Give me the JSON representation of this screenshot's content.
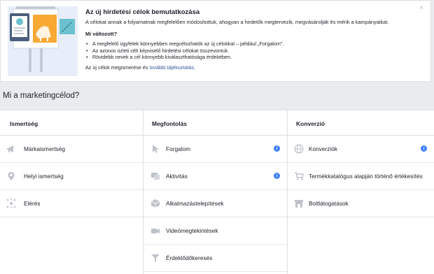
{
  "notice": {
    "title": "Az új hirdetési célok bemutatkozása",
    "text": "A célokat annak a folyamatnak megfelelően módosítottuk, ahogyan a hirdetők megtervezik, megvásárolják és mérik a kampányaikat.",
    "subtitle": "Mi változott?",
    "bullets": [
      "A megfelelő ügyfelek könnyebben megcélozhatók az új célokkal – például „Forgalom\".",
      "Az azonos üzleti célt képviselő hirdetési célokat összevontuk.",
      "Rövidebb nevek a cél könnyebb kiválaszthatósága érdekében."
    ],
    "more_prefix": "Az új célok megismerése és ",
    "more_link": "további tájékoztatás",
    "more_suffix": ".",
    "close": "×"
  },
  "question": "Mi a marketingcélod?",
  "columns": [
    {
      "header": "Ismertség",
      "items": [
        {
          "label": "Márkaismertség",
          "icon": "megaphone-icon"
        },
        {
          "label": "Helyi ismertség",
          "icon": "location-pin-icon"
        },
        {
          "label": "Elérés",
          "icon": "reach-burst-icon"
        }
      ]
    },
    {
      "header": "Megfontolás",
      "items": [
        {
          "label": "Forgalom",
          "icon": "cursor-icon",
          "info": "i"
        },
        {
          "label": "Aktivitás",
          "icon": "chat-bubbles-icon",
          "info": "i"
        },
        {
          "label": "Alkalmazástelepítések",
          "icon": "box-icon"
        },
        {
          "label": "Videómegtekintések",
          "icon": "video-camera-icon"
        },
        {
          "label": "Érdeklődőkeresés",
          "icon": "funnel-icon"
        }
      ]
    },
    {
      "header": "Konverzió",
      "items": [
        {
          "label": "Konverziók",
          "icon": "globe-icon",
          "info": "i"
        },
        {
          "label": "Termékkatalógus alapján történő értékesítés",
          "icon": "cart-icon"
        },
        {
          "label": "Boltlátogatások",
          "icon": "store-icon"
        }
      ]
    }
  ],
  "colors": {
    "link": "#365899",
    "info_badge": "#4080ff",
    "icon_gray": "#90949c",
    "illustration_bg": "#e8eef9"
  }
}
